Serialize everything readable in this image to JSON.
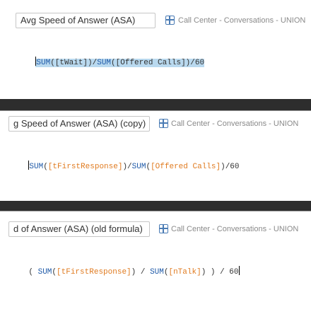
{
  "panels": [
    {
      "name_field": "Avg Speed of Answer (ASA)",
      "datasource": "Call Center - Conversations - UNION",
      "formula": [
        {
          "t": "SUM",
          "c": "kw"
        },
        {
          "t": "([tWait])/",
          "c": "plain"
        },
        {
          "t": "SUM",
          "c": "kw"
        },
        {
          "t": "([Offered Calls])/60",
          "c": "plain"
        }
      ]
    },
    {
      "name_field": "g Speed of Answer (ASA) (copy)",
      "datasource": "Call Center - Conversations - UNION",
      "formula": [
        {
          "t": "SUM",
          "c": "kw"
        },
        {
          "t": "(",
          "c": "op"
        },
        {
          "t": "[tFirstResponse]",
          "c": "fld"
        },
        {
          "t": ")/",
          "c": "op"
        },
        {
          "t": "SUM",
          "c": "kw"
        },
        {
          "t": "(",
          "c": "op"
        },
        {
          "t": "[Offered Calls]",
          "c": "fld"
        },
        {
          "t": ")/60",
          "c": "op"
        }
      ]
    },
    {
      "name_field": "d of Answer (ASA) (old formula)",
      "datasource": "Call Center - Conversations - UNION",
      "formula": [
        {
          "t": "( ",
          "c": "op"
        },
        {
          "t": "SUM",
          "c": "kw"
        },
        {
          "t": "(",
          "c": "op"
        },
        {
          "t": "[tFirstResponse]",
          "c": "fld"
        },
        {
          "t": ") / ",
          "c": "op"
        },
        {
          "t": "SUM",
          "c": "kw"
        },
        {
          "t": "(",
          "c": "op"
        },
        {
          "t": "[nTalk]",
          "c": "fld"
        },
        {
          "t": ") ) / 60",
          "c": "op"
        }
      ]
    }
  ],
  "colors": {
    "keyword": "#1f5aa8",
    "field": "#e07b20",
    "operator": "#333333",
    "selection": "#b9d9ef",
    "separator": "#2d2d2d"
  },
  "icons": {
    "datasource": "datasource-grid-icon"
  }
}
